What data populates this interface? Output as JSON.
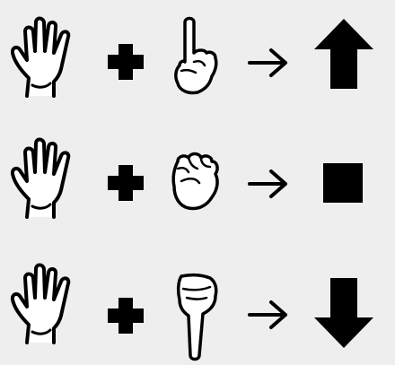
{
  "rows": [
    {
      "left": "open-hand-icon",
      "op": "plus-icon",
      "right": "hand-pointing-up-icon",
      "result": "arrow-up-icon"
    },
    {
      "left": "open-hand-icon",
      "op": "plus-icon",
      "right": "fist-icon",
      "result": "stop-square-icon"
    },
    {
      "left": "open-hand-icon",
      "op": "plus-icon",
      "right": "hand-pointing-down-icon",
      "result": "arrow-down-icon"
    }
  ],
  "colors": {
    "background": "#eeeeee",
    "ink": "#000000",
    "hand_fill": "#ffffff"
  }
}
